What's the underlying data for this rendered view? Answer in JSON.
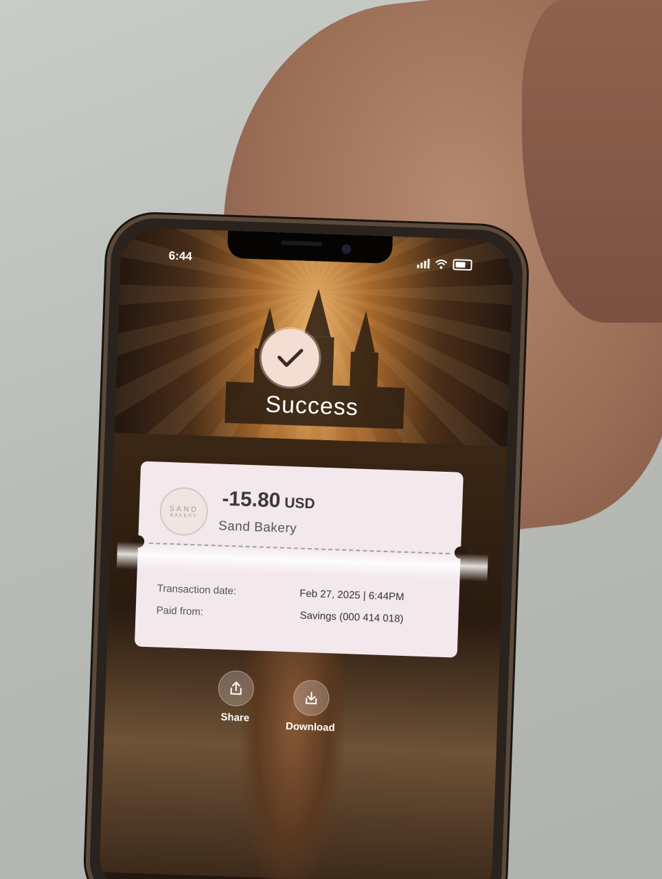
{
  "status_bar": {
    "time": "6:44"
  },
  "result": {
    "title": "Success"
  },
  "receipt": {
    "merchant_logo_text": "SAND",
    "merchant_logo_subtext": "BAKERY",
    "amount": "-15.80",
    "currency": "USD",
    "merchant": "Sand Bakery",
    "transaction_date_label": "Transaction date:",
    "transaction_date_value": "Feb 27, 2025 | 6:44PM",
    "paid_from_label": "Paid from:",
    "paid_from_value": "Savings (000 414 018)"
  },
  "actions": {
    "share_label": "Share",
    "download_label": "Download"
  },
  "colors": {
    "card_bg": "#f3e8ec",
    "check_circle_bg": "#f4ddd3"
  }
}
